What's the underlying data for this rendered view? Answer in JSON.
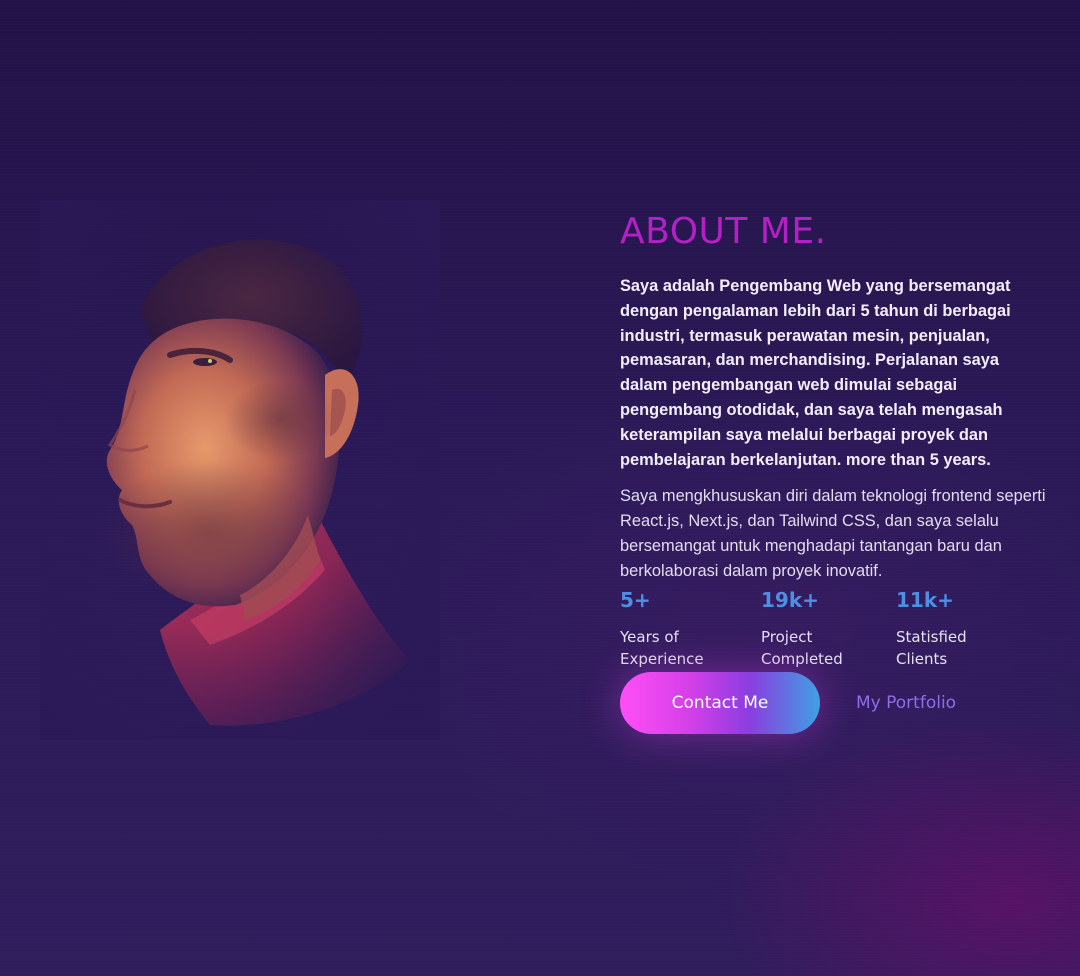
{
  "about": {
    "title": "ABOUT ME.",
    "paragraph_1": "Saya adalah Pengembang Web yang bersemangat dengan pengalaman lebih dari 5 tahun di berbagai industri, termasuk perawatan mesin, penjualan, pemasaran, dan merchandising. Perjalanan saya dalam pengembangan web dimulai sebagai pengembang otodidak, dan saya telah mengasah keterampilan saya melalui berbagai proyek dan pembelajaran berkelanjutan. more than 5 years.",
    "paragraph_2": "Saya mengkhususkan diri dalam teknologi frontend seperti React.js, Next.js, dan Tailwind CSS, dan saya selalu bersemangat untuk menghadapi tantangan baru dan berkolaborasi dalam proyek inovatif."
  },
  "stats": [
    {
      "value": "5+",
      "label": "Years of Experience"
    },
    {
      "value": "19k+",
      "label": "Project Completed"
    },
    {
      "value": "11k+",
      "label": "Statisfied Clients"
    }
  ],
  "actions": {
    "contact_label": "Contact Me",
    "portfolio_label": "My Portfolio"
  },
  "portrait": {
    "alt": "portrait photo"
  },
  "colors": {
    "background": "#2b1957",
    "title": "#b51fc6",
    "stat_value": "#4e8fe6",
    "button_gradient_start": "#ff4ff7",
    "button_gradient_end": "#3fa0e4",
    "link": "#8f6de8"
  }
}
